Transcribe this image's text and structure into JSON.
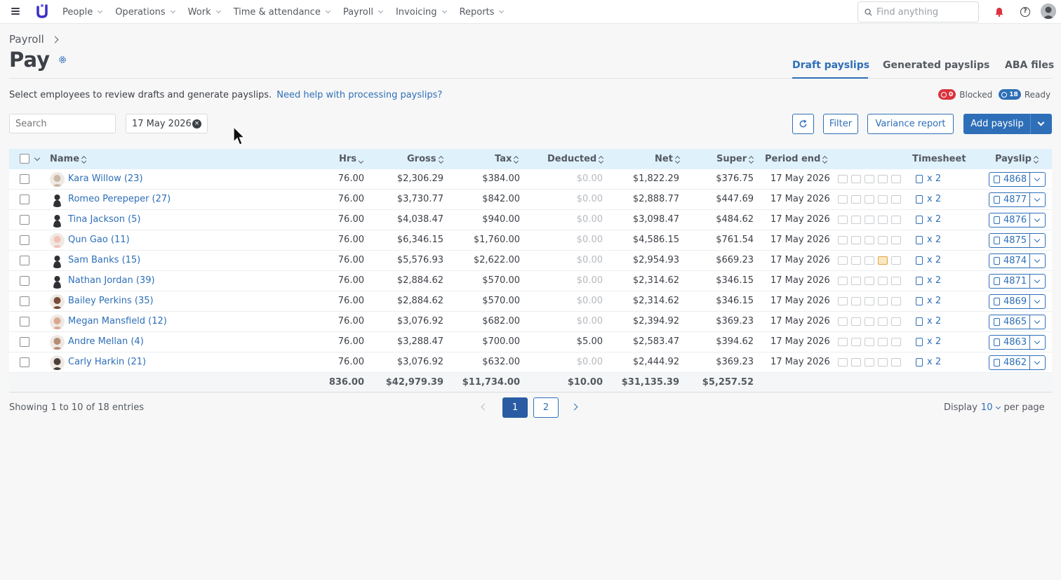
{
  "topnav": {
    "items": [
      "People",
      "Operations",
      "Work",
      "Time & attendance",
      "Payroll",
      "Invoicing",
      "Reports"
    ],
    "search_placeholder": "Find anything"
  },
  "header": {
    "breadcrumb": "Payroll",
    "title": "Pay",
    "tabs": [
      "Draft payslips",
      "Generated payslips",
      "ABA files"
    ],
    "active_tab": "Draft payslips"
  },
  "intro": {
    "text": "Select employees to review drafts and generate payslips.",
    "help_link": "Need help with processing payslips?"
  },
  "status": {
    "blocked_count": "0",
    "blocked_label": "Blocked",
    "ready_count": "18",
    "ready_label": "Ready"
  },
  "toolbar": {
    "search_placeholder": "Search",
    "date_filter": "17 May 2026",
    "filter_label": "Filter",
    "variance_label": "Variance report",
    "add_label": "Add payslip"
  },
  "table": {
    "columns": {
      "name": "Name",
      "hrs": "Hrs",
      "gross": "Gross",
      "tax": "Tax",
      "deducted": "Deducted",
      "net": "Net",
      "super": "Super",
      "period_end": "Period end",
      "timesheet": "Timesheet",
      "payslip": "Payslip"
    },
    "rows": [
      {
        "name": "Kara Willow (23)",
        "hrs": "76.00",
        "gross": "$2,306.29",
        "tax": "$384.00",
        "deducted": "$0.00",
        "net": "$1,822.29",
        "super": "$376.75",
        "period_end": "17 May 2026",
        "timesheet": "x 2",
        "payslip": "4868"
      },
      {
        "name": "Romeo Perepeper (27)",
        "hrs": "76.00",
        "gross": "$3,730.77",
        "tax": "$842.00",
        "deducted": "$0.00",
        "net": "$2,888.77",
        "super": "$447.69",
        "period_end": "17 May 2026",
        "timesheet": "x 2",
        "payslip": "4877"
      },
      {
        "name": "Tina Jackson (5)",
        "hrs": "76.00",
        "gross": "$4,038.47",
        "tax": "$940.00",
        "deducted": "$0.00",
        "net": "$3,098.47",
        "super": "$484.62",
        "period_end": "17 May 2026",
        "timesheet": "x 2",
        "payslip": "4876"
      },
      {
        "name": "Qun Gao (11)",
        "hrs": "76.00",
        "gross": "$6,346.15",
        "tax": "$1,760.00",
        "deducted": "$0.00",
        "net": "$4,586.15",
        "super": "$761.54",
        "period_end": "17 May 2026",
        "timesheet": "x 2",
        "payslip": "4875"
      },
      {
        "name": "Sam Banks (15)",
        "hrs": "76.00",
        "gross": "$5,576.93",
        "tax": "$2,622.00",
        "deducted": "$0.00",
        "net": "$2,954.93",
        "super": "$669.23",
        "period_end": "17 May 2026",
        "timesheet": "x 2",
        "payslip": "4874"
      },
      {
        "name": "Nathan Jordan (39)",
        "hrs": "76.00",
        "gross": "$2,884.62",
        "tax": "$570.00",
        "deducted": "$0.00",
        "net": "$2,314.62",
        "super": "$346.15",
        "period_end": "17 May 2026",
        "timesheet": "x 2",
        "payslip": "4871"
      },
      {
        "name": "Bailey Perkins (35)",
        "hrs": "76.00",
        "gross": "$2,884.62",
        "tax": "$570.00",
        "deducted": "$0.00",
        "net": "$2,314.62",
        "super": "$346.15",
        "period_end": "17 May 2026",
        "timesheet": "x 2",
        "payslip": "4869"
      },
      {
        "name": "Megan Mansfield (12)",
        "hrs": "76.00",
        "gross": "$3,076.92",
        "tax": "$682.00",
        "deducted": "$0.00",
        "net": "$2,394.92",
        "super": "$369.23",
        "period_end": "17 May 2026",
        "timesheet": "x 2",
        "payslip": "4865"
      },
      {
        "name": "Andre Mellan (4)",
        "hrs": "76.00",
        "gross": "$3,288.47",
        "tax": "$700.00",
        "deducted": "$5.00",
        "net": "$2,583.47",
        "super": "$394.62",
        "period_end": "17 May 2026",
        "timesheet": "x 2",
        "payslip": "4863"
      },
      {
        "name": "Carly Harkin (21)",
        "hrs": "76.00",
        "gross": "$3,076.92",
        "tax": "$632.00",
        "deducted": "$0.00",
        "net": "$2,444.92",
        "super": "$369.23",
        "period_end": "17 May 2026",
        "timesheet": "x 2",
        "payslip": "4862"
      }
    ],
    "totals": {
      "hrs": "836.00",
      "gross": "$42,979.39",
      "tax": "$11,734.00",
      "deducted": "$10.00",
      "net": "$31,135.39",
      "super": "$5,257.52"
    }
  },
  "footer": {
    "showing": "Showing 1 to 10 of 18 entries",
    "pages": [
      "1",
      "2"
    ],
    "current_page": "1",
    "display_label": "Display",
    "per_page_value": "10",
    "per_page_suffix": "per page"
  },
  "colors": {
    "accent": "#2e6fb8",
    "header_bg": "#dff1fb",
    "blocked": "#d9333f"
  }
}
